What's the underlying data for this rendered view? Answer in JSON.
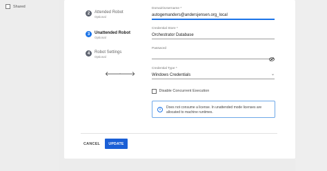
{
  "shared": {
    "label": "Shared"
  },
  "steps": [
    {
      "number": "2",
      "title": "Attended Robot",
      "subtitle": "Optional"
    },
    {
      "number": "3",
      "title": "Unattended Robot",
      "subtitle": "Optional"
    },
    {
      "number": "4",
      "title": "Robot Settings",
      "subtitle": "Optional"
    }
  ],
  "nav": {
    "prev_icon": "arrow-left-icon",
    "next_icon": "arrow-right-icon",
    "prev_glyph": "🡐",
    "next_glyph": "🡒"
  },
  "form": {
    "domain": {
      "label": "Domain\\Username *",
      "value": "autogemanders@andersjensen.org_local"
    },
    "credential_store": {
      "label": "Credential Store *",
      "value": "Orchestrator Database"
    },
    "password": {
      "label": "Password",
      "value": "",
      "icon": "eye-off-icon"
    },
    "credential_type": {
      "label": "Credential Type *",
      "value": "Windows Credentials",
      "icon": "chevron-down-icon",
      "chevron": "⌄"
    },
    "disable_concurrent": {
      "label": "Disable Concurrent Execution",
      "checked": false
    },
    "info": {
      "icon": "info-icon",
      "glyph": "i",
      "text": "Does not consume a license. In unattended mode licenses are allocated to machine runtimes."
    }
  },
  "actions": {
    "cancel_label": "CANCEL",
    "update_label": "UPDATE"
  },
  "colors": {
    "accent": "#1a73e8",
    "primary_button": "#1a5fd6",
    "info_border": "#6ca7e8"
  }
}
